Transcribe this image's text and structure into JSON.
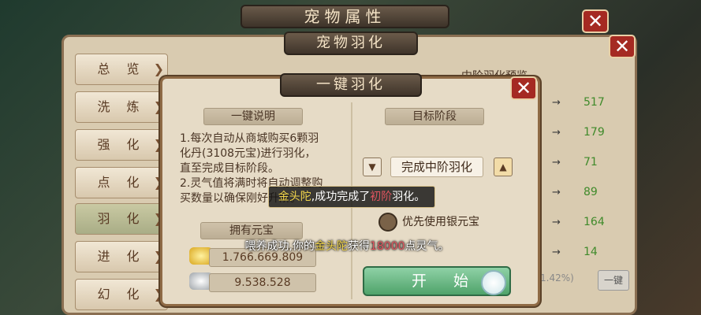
{
  "window": {
    "title": "宠物属性"
  },
  "panel": {
    "title": "宠物羽化"
  },
  "nav": {
    "items": [
      {
        "label": "总 览"
      },
      {
        "label": "洗 炼"
      },
      {
        "label": "强 化"
      },
      {
        "label": "点 化"
      },
      {
        "label": "羽 化"
      },
      {
        "label": "进 化"
      },
      {
        "label": "幻 化"
      }
    ]
  },
  "background_list": {
    "header": "中阶羽化预览",
    "values": [
      "517",
      "179",
      "71",
      "89",
      "164",
      "14"
    ],
    "progress": "1.42%)",
    "onekey": "一键"
  },
  "dialog": {
    "title": "一键羽化",
    "instructions_title": "一键说明",
    "instructions": [
      "1.每次自动从商城购买6颗羽",
      "化丹(3108元宝)进行羽化，",
      "直至完成目标阶段。",
      "2.灵气值将满时将自动调整购",
      "买数量以确保刚好升阶。"
    ],
    "owned_title": "拥有元宝",
    "gold_ingot": "1.766.669.809",
    "silver_ingot": "9.538.528",
    "target_title": "目标阶段",
    "target_value": "完成中阶羽化",
    "radio_label": "优先使用银元宝",
    "start_label": "开 始"
  },
  "toast": {
    "pet": "金头陀",
    "pre": ",成功完成了",
    "stage": "初阶",
    "post": "羽化。"
  },
  "message": {
    "pre": "喂养成功,你的",
    "pet": "金头陀",
    "mid": "获得",
    "amount": "18000",
    "post": "点灵气。"
  },
  "colors": {
    "accent_green": "#4fa36a",
    "close_red": "#a52a22",
    "highlight_yellow": "#f2d64b",
    "highlight_red": "#e0555f",
    "value_green": "#3f8a2a"
  }
}
